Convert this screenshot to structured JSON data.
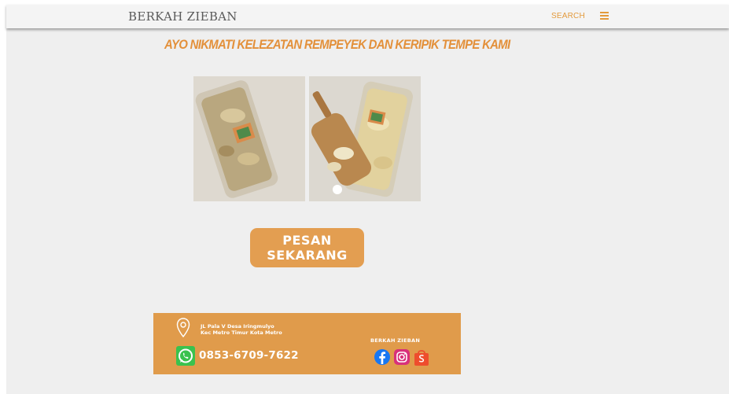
{
  "header": {
    "brand": "BERKAH ZIEBAN",
    "search_label": "SEARCH",
    "menu_icon": "hamburger-menu-icon"
  },
  "main": {
    "headline": "AYO NIKMATI  KELEZATAN REMPEYEK DAN KERIPIK TEMPE KAMI",
    "photos": [
      "product-photo-rempeyek",
      "product-photo-keripik-tempe"
    ],
    "order_button": {
      "line1": "PESAN",
      "line2": "SEKARANG"
    }
  },
  "footer": {
    "address_line1": "JL Pala V Desa Iringmulyo",
    "address_line2": "Kec Metro Timur Kota Metro",
    "phone": "0853-6709-7622",
    "brand": "BERKAH ZIEBAN",
    "icons": [
      "location-pin-icon",
      "whatsapp-icon",
      "facebook-icon",
      "instagram-icon",
      "shopee-icon"
    ]
  },
  "colors": {
    "accent": "#e39a3c",
    "footer_bg": "#e09b4b",
    "page_bg": "#efefef",
    "whatsapp": "#3ac24e"
  }
}
